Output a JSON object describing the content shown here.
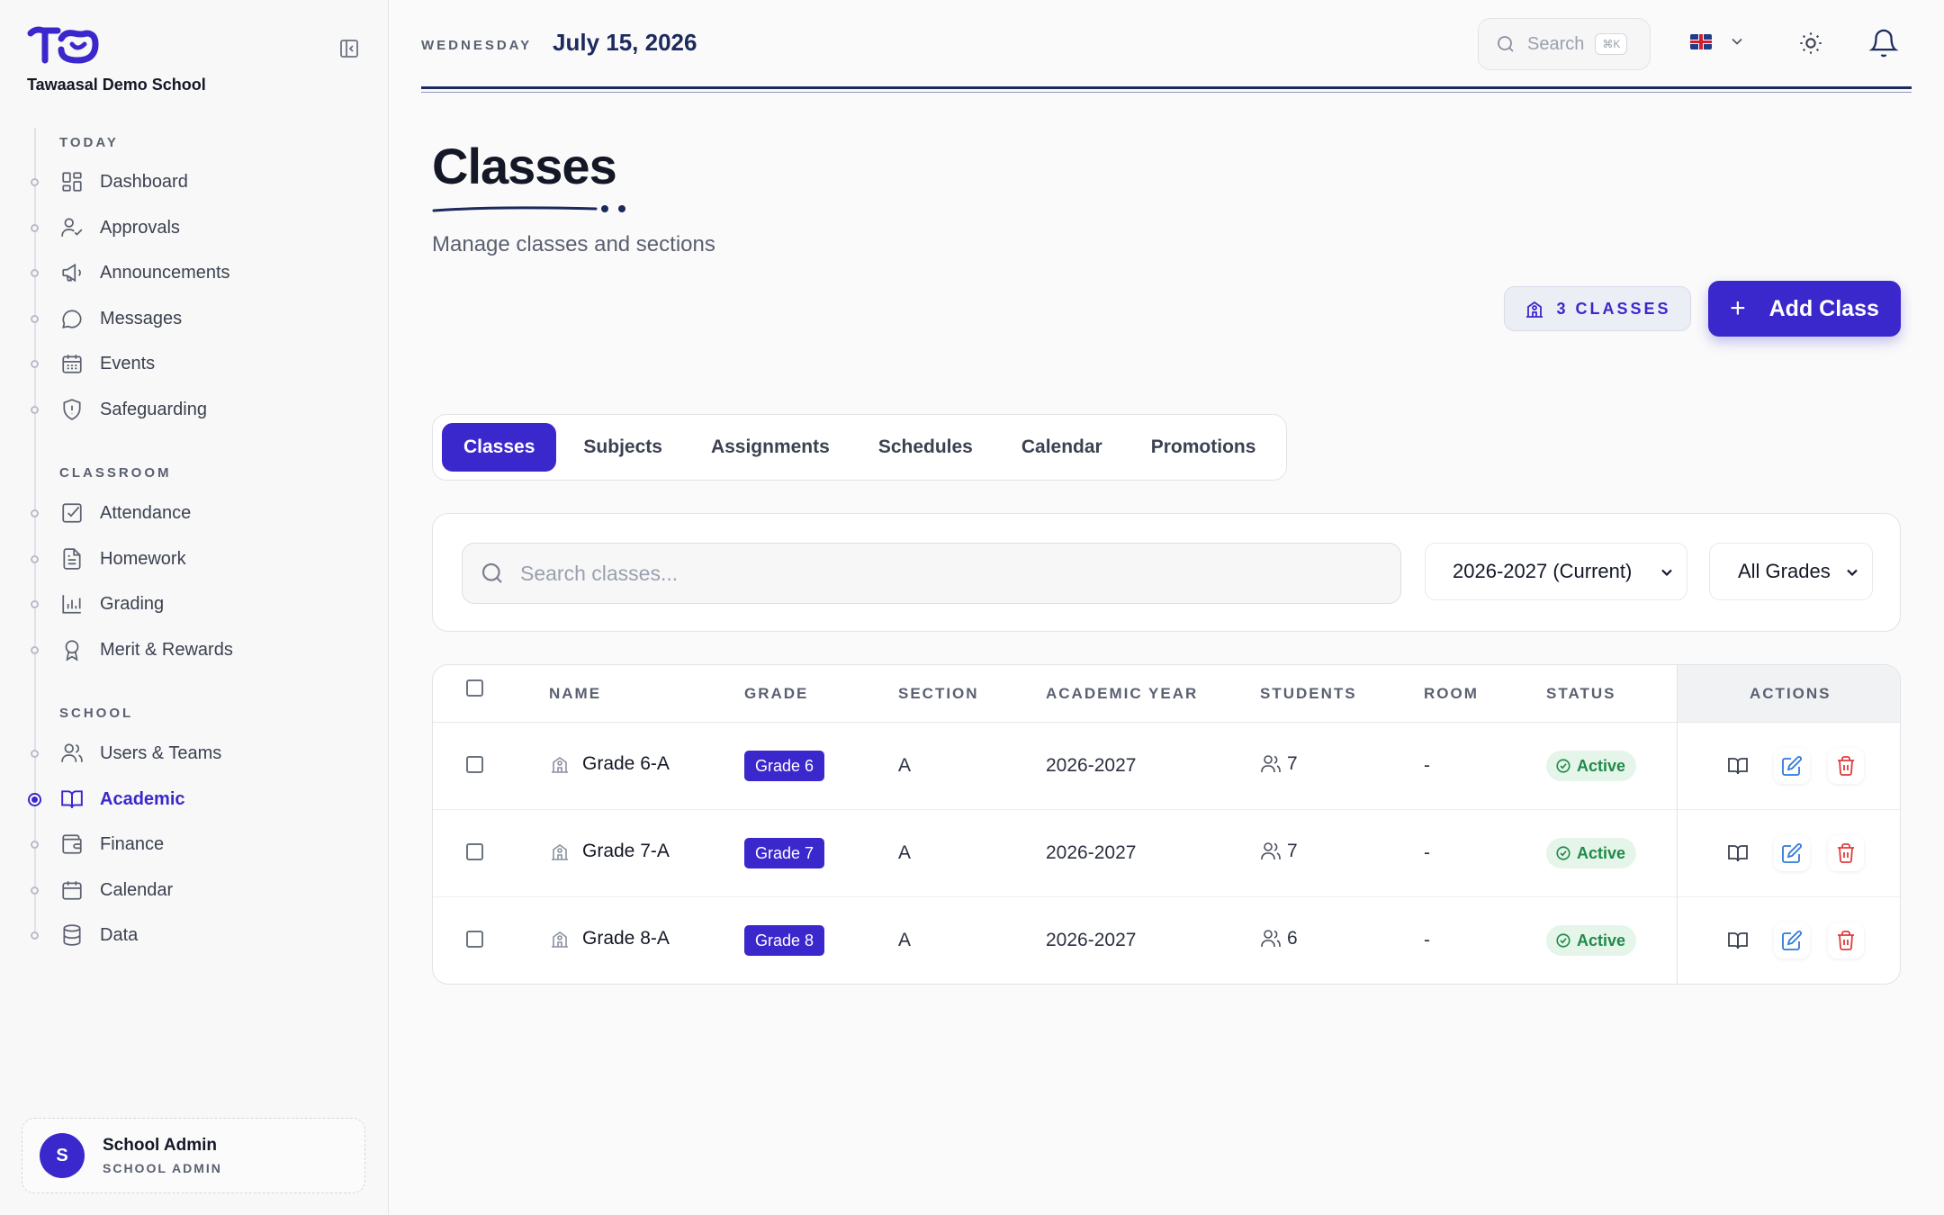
{
  "sidebar": {
    "school_name": "Tawaasal Demo School",
    "sections": {
      "today": "TODAY",
      "classroom": "CLASSROOM",
      "school": "SCHOOL"
    },
    "items": [
      {
        "label": "Dashboard",
        "icon": "dashboard-icon"
      },
      {
        "label": "Approvals",
        "icon": "user-check-icon"
      },
      {
        "label": "Announcements",
        "icon": "megaphone-icon"
      },
      {
        "label": "Messages",
        "icon": "message-icon"
      },
      {
        "label": "Events",
        "icon": "calendar-grid-icon"
      },
      {
        "label": "Safeguarding",
        "icon": "shield-alert-icon"
      },
      {
        "label": "Attendance",
        "icon": "checkbox-icon"
      },
      {
        "label": "Homework",
        "icon": "document-icon"
      },
      {
        "label": "Grading",
        "icon": "bar-chart-icon"
      },
      {
        "label": "Merit & Rewards",
        "icon": "award-icon"
      },
      {
        "label": "Users & Teams",
        "icon": "users-icon"
      },
      {
        "label": "Academic",
        "icon": "book-open-icon",
        "active": true
      },
      {
        "label": "Finance",
        "icon": "wallet-icon"
      },
      {
        "label": "Calendar",
        "icon": "calendar-icon"
      },
      {
        "label": "Data",
        "icon": "database-icon"
      }
    ],
    "user": {
      "initial": "S",
      "name": "School Admin",
      "role": "SCHOOL ADMIN"
    }
  },
  "topbar": {
    "weekday": "WEDNESDAY",
    "date": "July 15, 2026",
    "search_label": "Search",
    "search_shortcut": "⌘K"
  },
  "page": {
    "title": "Classes",
    "subtitle": "Manage classes and sections",
    "count_badge": "3 CLASSES",
    "add_button": "Add Class",
    "add_button_icon": "+"
  },
  "tabs": [
    {
      "label": "Classes",
      "active": true
    },
    {
      "label": "Subjects"
    },
    {
      "label": "Assignments"
    },
    {
      "label": "Schedules"
    },
    {
      "label": "Calendar"
    },
    {
      "label": "Promotions"
    }
  ],
  "filters": {
    "search_placeholder": "Search classes...",
    "year_selected": "2026-2027 (Current)",
    "grade_selected": "All Grades"
  },
  "table": {
    "headers": {
      "name": "NAME",
      "grade": "GRADE",
      "section": "SECTION",
      "year": "ACADEMIC YEAR",
      "students": "STUDENTS",
      "room": "ROOM",
      "status": "STATUS",
      "actions": "ACTIONS"
    },
    "rows": [
      {
        "name": "Grade 6-A",
        "grade": "Grade 6",
        "section": "A",
        "year": "2026-2027",
        "students": "7",
        "room": "-",
        "status": "Active"
      },
      {
        "name": "Grade 7-A",
        "grade": "Grade 7",
        "section": "A",
        "year": "2026-2027",
        "students": "7",
        "room": "-",
        "status": "Active"
      },
      {
        "name": "Grade 8-A",
        "grade": "Grade 8",
        "section": "A",
        "year": "2026-2027",
        "students": "6",
        "room": "-",
        "status": "Active"
      }
    ]
  },
  "colors": {
    "accent": "#3b28cc",
    "navy": "#1c2a5e",
    "status_active_bg": "#e5f5ea",
    "status_active_text": "#1f8a47",
    "delete": "#e23b3b",
    "edit": "#2f7ad8"
  }
}
